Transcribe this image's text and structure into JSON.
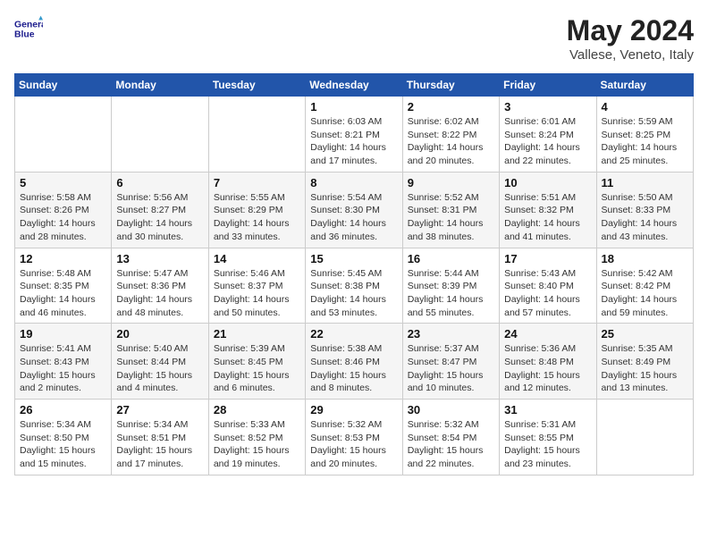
{
  "header": {
    "logo_line1": "General",
    "logo_line2": "Blue",
    "month_title": "May 2024",
    "location": "Vallese, Veneto, Italy"
  },
  "weekdays": [
    "Sunday",
    "Monday",
    "Tuesday",
    "Wednesday",
    "Thursday",
    "Friday",
    "Saturday"
  ],
  "weeks": [
    [
      {
        "day": "",
        "sunrise": "",
        "sunset": "",
        "daylight": ""
      },
      {
        "day": "",
        "sunrise": "",
        "sunset": "",
        "daylight": ""
      },
      {
        "day": "",
        "sunrise": "",
        "sunset": "",
        "daylight": ""
      },
      {
        "day": "1",
        "sunrise": "Sunrise: 6:03 AM",
        "sunset": "Sunset: 8:21 PM",
        "daylight": "Daylight: 14 hours and 17 minutes."
      },
      {
        "day": "2",
        "sunrise": "Sunrise: 6:02 AM",
        "sunset": "Sunset: 8:22 PM",
        "daylight": "Daylight: 14 hours and 20 minutes."
      },
      {
        "day": "3",
        "sunrise": "Sunrise: 6:01 AM",
        "sunset": "Sunset: 8:24 PM",
        "daylight": "Daylight: 14 hours and 22 minutes."
      },
      {
        "day": "4",
        "sunrise": "Sunrise: 5:59 AM",
        "sunset": "Sunset: 8:25 PM",
        "daylight": "Daylight: 14 hours and 25 minutes."
      }
    ],
    [
      {
        "day": "5",
        "sunrise": "Sunrise: 5:58 AM",
        "sunset": "Sunset: 8:26 PM",
        "daylight": "Daylight: 14 hours and 28 minutes."
      },
      {
        "day": "6",
        "sunrise": "Sunrise: 5:56 AM",
        "sunset": "Sunset: 8:27 PM",
        "daylight": "Daylight: 14 hours and 30 minutes."
      },
      {
        "day": "7",
        "sunrise": "Sunrise: 5:55 AM",
        "sunset": "Sunset: 8:29 PM",
        "daylight": "Daylight: 14 hours and 33 minutes."
      },
      {
        "day": "8",
        "sunrise": "Sunrise: 5:54 AM",
        "sunset": "Sunset: 8:30 PM",
        "daylight": "Daylight: 14 hours and 36 minutes."
      },
      {
        "day": "9",
        "sunrise": "Sunrise: 5:52 AM",
        "sunset": "Sunset: 8:31 PM",
        "daylight": "Daylight: 14 hours and 38 minutes."
      },
      {
        "day": "10",
        "sunrise": "Sunrise: 5:51 AM",
        "sunset": "Sunset: 8:32 PM",
        "daylight": "Daylight: 14 hours and 41 minutes."
      },
      {
        "day": "11",
        "sunrise": "Sunrise: 5:50 AM",
        "sunset": "Sunset: 8:33 PM",
        "daylight": "Daylight: 14 hours and 43 minutes."
      }
    ],
    [
      {
        "day": "12",
        "sunrise": "Sunrise: 5:48 AM",
        "sunset": "Sunset: 8:35 PM",
        "daylight": "Daylight: 14 hours and 46 minutes."
      },
      {
        "day": "13",
        "sunrise": "Sunrise: 5:47 AM",
        "sunset": "Sunset: 8:36 PM",
        "daylight": "Daylight: 14 hours and 48 minutes."
      },
      {
        "day": "14",
        "sunrise": "Sunrise: 5:46 AM",
        "sunset": "Sunset: 8:37 PM",
        "daylight": "Daylight: 14 hours and 50 minutes."
      },
      {
        "day": "15",
        "sunrise": "Sunrise: 5:45 AM",
        "sunset": "Sunset: 8:38 PM",
        "daylight": "Daylight: 14 hours and 53 minutes."
      },
      {
        "day": "16",
        "sunrise": "Sunrise: 5:44 AM",
        "sunset": "Sunset: 8:39 PM",
        "daylight": "Daylight: 14 hours and 55 minutes."
      },
      {
        "day": "17",
        "sunrise": "Sunrise: 5:43 AM",
        "sunset": "Sunset: 8:40 PM",
        "daylight": "Daylight: 14 hours and 57 minutes."
      },
      {
        "day": "18",
        "sunrise": "Sunrise: 5:42 AM",
        "sunset": "Sunset: 8:42 PM",
        "daylight": "Daylight: 14 hours and 59 minutes."
      }
    ],
    [
      {
        "day": "19",
        "sunrise": "Sunrise: 5:41 AM",
        "sunset": "Sunset: 8:43 PM",
        "daylight": "Daylight: 15 hours and 2 minutes."
      },
      {
        "day": "20",
        "sunrise": "Sunrise: 5:40 AM",
        "sunset": "Sunset: 8:44 PM",
        "daylight": "Daylight: 15 hours and 4 minutes."
      },
      {
        "day": "21",
        "sunrise": "Sunrise: 5:39 AM",
        "sunset": "Sunset: 8:45 PM",
        "daylight": "Daylight: 15 hours and 6 minutes."
      },
      {
        "day": "22",
        "sunrise": "Sunrise: 5:38 AM",
        "sunset": "Sunset: 8:46 PM",
        "daylight": "Daylight: 15 hours and 8 minutes."
      },
      {
        "day": "23",
        "sunrise": "Sunrise: 5:37 AM",
        "sunset": "Sunset: 8:47 PM",
        "daylight": "Daylight: 15 hours and 10 minutes."
      },
      {
        "day": "24",
        "sunrise": "Sunrise: 5:36 AM",
        "sunset": "Sunset: 8:48 PM",
        "daylight": "Daylight: 15 hours and 12 minutes."
      },
      {
        "day": "25",
        "sunrise": "Sunrise: 5:35 AM",
        "sunset": "Sunset: 8:49 PM",
        "daylight": "Daylight: 15 hours and 13 minutes."
      }
    ],
    [
      {
        "day": "26",
        "sunrise": "Sunrise: 5:34 AM",
        "sunset": "Sunset: 8:50 PM",
        "daylight": "Daylight: 15 hours and 15 minutes."
      },
      {
        "day": "27",
        "sunrise": "Sunrise: 5:34 AM",
        "sunset": "Sunset: 8:51 PM",
        "daylight": "Daylight: 15 hours and 17 minutes."
      },
      {
        "day": "28",
        "sunrise": "Sunrise: 5:33 AM",
        "sunset": "Sunset: 8:52 PM",
        "daylight": "Daylight: 15 hours and 19 minutes."
      },
      {
        "day": "29",
        "sunrise": "Sunrise: 5:32 AM",
        "sunset": "Sunset: 8:53 PM",
        "daylight": "Daylight: 15 hours and 20 minutes."
      },
      {
        "day": "30",
        "sunrise": "Sunrise: 5:32 AM",
        "sunset": "Sunset: 8:54 PM",
        "daylight": "Daylight: 15 hours and 22 minutes."
      },
      {
        "day": "31",
        "sunrise": "Sunrise: 5:31 AM",
        "sunset": "Sunset: 8:55 PM",
        "daylight": "Daylight: 15 hours and 23 minutes."
      },
      {
        "day": "",
        "sunrise": "",
        "sunset": "",
        "daylight": ""
      }
    ]
  ]
}
